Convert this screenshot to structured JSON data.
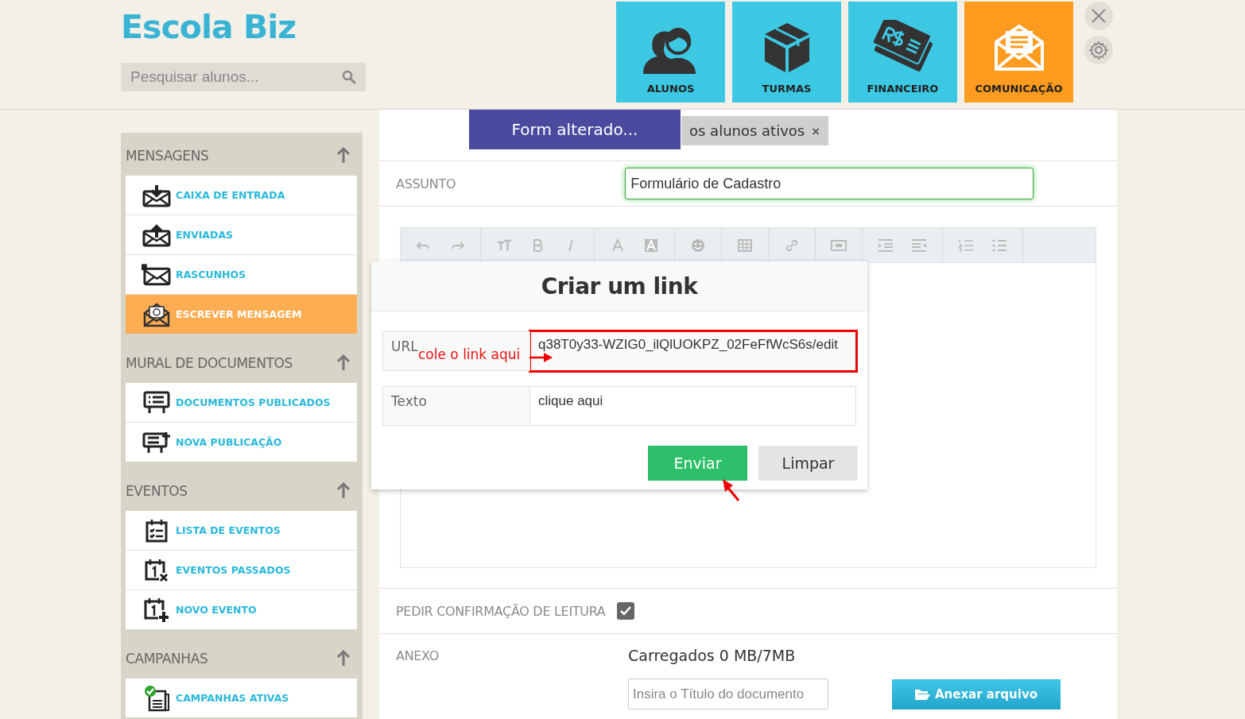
{
  "app": {
    "logo": "Escola Biz"
  },
  "search": {
    "placeholder": "Pesquisar alunos..."
  },
  "nav_tiles": [
    {
      "label": "ALUNOS",
      "selected": false
    },
    {
      "label": "TURMAS",
      "selected": false
    },
    {
      "label": "FINANCEIRO",
      "selected": false
    },
    {
      "label": "COMUNICAÇÃO",
      "selected": true
    }
  ],
  "sidebar": {
    "sections": [
      {
        "title": "MENSAGENS",
        "expanded": true,
        "items": [
          {
            "label": "CAIXA DE ENTRADA",
            "selected": false
          },
          {
            "label": "ENVIADAS",
            "selected": false
          },
          {
            "label": "RASCUNHOS",
            "selected": false
          },
          {
            "label": "ESCREVER MENSAGEM",
            "selected": true
          }
        ]
      },
      {
        "title": "MURAL DE DOCUMENTOS",
        "expanded": true,
        "items": [
          {
            "label": "DOCUMENTOS PUBLICADOS",
            "selected": false
          },
          {
            "label": "NOVA PUBLICAÇÃO",
            "selected": false
          }
        ]
      },
      {
        "title": "EVENTOS",
        "expanded": true,
        "items": [
          {
            "label": "LISTA DE EVENTOS",
            "selected": false
          },
          {
            "label": "EVENTOS PASSADOS",
            "selected": false
          },
          {
            "label": "NOVO EVENTO",
            "selected": false
          }
        ]
      },
      {
        "title": "CAMPANHAS",
        "expanded": true,
        "items": [
          {
            "label": "CAMPANHAS ATIVAS",
            "selected": false
          }
        ]
      }
    ]
  },
  "notification": {
    "text": "Form alterado..."
  },
  "recipients": [
    {
      "label": "os alunos ativos",
      "remove": "×"
    }
  ],
  "subject": {
    "label": "ASSUNTO",
    "value": "Formulário de Cadastro"
  },
  "link_dialog": {
    "title": "Criar um link",
    "fields": [
      {
        "label": "URL",
        "value": "q38T0y33-WZIG0_ilQlUOKPZ_02FeFfWcS6s/edit",
        "highlighted": true
      },
      {
        "label": "Texto",
        "value": "clique aqui",
        "highlighted": false
      }
    ],
    "buttons": [
      {
        "label": "Enviar",
        "kind": "primary"
      },
      {
        "label": "Limpar",
        "kind": "secondary"
      }
    ]
  },
  "annotation": {
    "text": "cole o link aqui"
  },
  "read_receipt": {
    "label": "PEDIR CONFIRMAÇÃO DE LEITURA",
    "checked": true
  },
  "attachment": {
    "label": "ANEXO",
    "usage": "Carregados 0 MB/7MB",
    "title_placeholder": "Insira o Título do documento",
    "button": "Anexar arquivo"
  }
}
